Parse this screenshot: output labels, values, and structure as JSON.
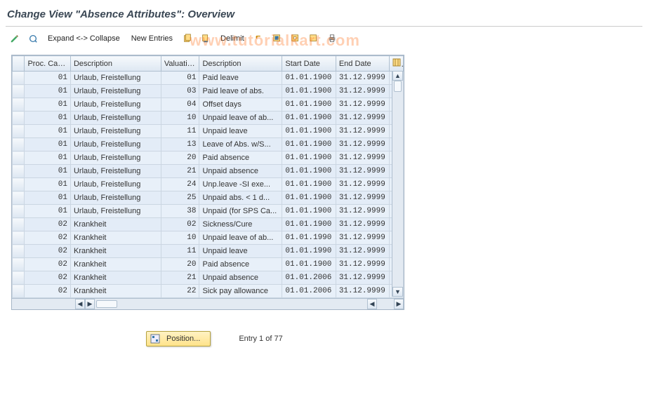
{
  "window": {
    "title": "Change View \"Absence Attributes\": Overview"
  },
  "toolbar": {
    "expand_collapse": "Expand <-> Collapse",
    "new_entries": "New Entries",
    "delimit": "Delimit"
  },
  "watermark": "www.tutorialkart.com",
  "grid": {
    "columns": {
      "proc": "Proc. Cate...",
      "desc1": "Description",
      "val": "Valuatio...",
      "desc2": "Description",
      "start": "Start Date",
      "end": "End Date"
    },
    "rows": [
      {
        "proc": "01",
        "desc1": "Urlaub, Freistellung",
        "val": "01",
        "desc2": "Paid leave",
        "start": "01.01.1900",
        "end": "31.12.9999"
      },
      {
        "proc": "01",
        "desc1": "Urlaub, Freistellung",
        "val": "03",
        "desc2": "Paid leave of abs.",
        "start": "01.01.1900",
        "end": "31.12.9999"
      },
      {
        "proc": "01",
        "desc1": "Urlaub, Freistellung",
        "val": "04",
        "desc2": "Offset days",
        "start": "01.01.1900",
        "end": "31.12.9999"
      },
      {
        "proc": "01",
        "desc1": "Urlaub, Freistellung",
        "val": "10",
        "desc2": "Unpaid leave of ab...",
        "start": "01.01.1900",
        "end": "31.12.9999"
      },
      {
        "proc": "01",
        "desc1": "Urlaub, Freistellung",
        "val": "11",
        "desc2": "Unpaid leave",
        "start": "01.01.1900",
        "end": "31.12.9999"
      },
      {
        "proc": "01",
        "desc1": "Urlaub, Freistellung",
        "val": "13",
        "desc2": "Leave of Abs. w/S...",
        "start": "01.01.1900",
        "end": "31.12.9999"
      },
      {
        "proc": "01",
        "desc1": "Urlaub, Freistellung",
        "val": "20",
        "desc2": "Paid absence",
        "start": "01.01.1900",
        "end": "31.12.9999"
      },
      {
        "proc": "01",
        "desc1": "Urlaub, Freistellung",
        "val": "21",
        "desc2": "Unpaid absence",
        "start": "01.01.1900",
        "end": "31.12.9999"
      },
      {
        "proc": "01",
        "desc1": "Urlaub, Freistellung",
        "val": "24",
        "desc2": "Unp.leave -SI exe...",
        "start": "01.01.1900",
        "end": "31.12.9999"
      },
      {
        "proc": "01",
        "desc1": "Urlaub, Freistellung",
        "val": "25",
        "desc2": "Unpaid abs. < 1 d...",
        "start": "01.01.1900",
        "end": "31.12.9999"
      },
      {
        "proc": "01",
        "desc1": "Urlaub, Freistellung",
        "val": "38",
        "desc2": "Unpaid (for SPS Ca...",
        "start": "01.01.1900",
        "end": "31.12.9999"
      },
      {
        "proc": "02",
        "desc1": "Krankheit",
        "val": "02",
        "desc2": "Sickness/Cure",
        "start": "01.01.1900",
        "end": "31.12.9999"
      },
      {
        "proc": "02",
        "desc1": "Krankheit",
        "val": "10",
        "desc2": "Unpaid leave of ab...",
        "start": "01.01.1990",
        "end": "31.12.9999"
      },
      {
        "proc": "02",
        "desc1": "Krankheit",
        "val": "11",
        "desc2": "Unpaid leave",
        "start": "01.01.1990",
        "end": "31.12.9999"
      },
      {
        "proc": "02",
        "desc1": "Krankheit",
        "val": "20",
        "desc2": "Paid absence",
        "start": "01.01.1900",
        "end": "31.12.9999"
      },
      {
        "proc": "02",
        "desc1": "Krankheit",
        "val": "21",
        "desc2": "Unpaid absence",
        "start": "01.01.2006",
        "end": "31.12.9999"
      },
      {
        "proc": "02",
        "desc1": "Krankheit",
        "val": "22",
        "desc2": "Sick pay allowance",
        "start": "01.01.2006",
        "end": "31.12.9999"
      }
    ]
  },
  "footer": {
    "position_label": "Position...",
    "entry_text": "Entry 1 of 77"
  }
}
